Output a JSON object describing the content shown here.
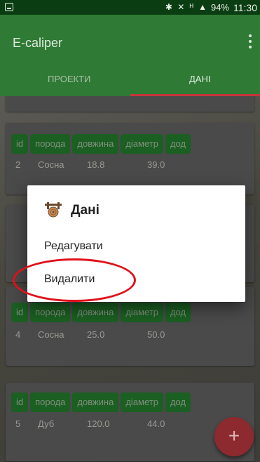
{
  "status_bar": {
    "system_icons": "✱ ✕ ᴴ ▲",
    "battery": "94%",
    "time": "11:30"
  },
  "app": {
    "title": "E-caliper"
  },
  "tabs": [
    {
      "label": "ПРОЕКТИ",
      "selected": false
    },
    {
      "label": "ДАНІ",
      "selected": true
    }
  ],
  "colors": {
    "primary": "#2f7a34",
    "primary_dark": "#0b3d12",
    "accent": "#c7353a",
    "annotation": "#e0101a"
  },
  "columns": [
    "id",
    "порода",
    "довжина",
    "діаметр",
    "дод"
  ],
  "records": [
    {
      "id": "2",
      "species": "Сосна",
      "length": "18.8",
      "diameter": "39.0"
    },
    {
      "id": "4",
      "species": "Сосна",
      "length": "25.0",
      "diameter": "50.0"
    },
    {
      "id": "5",
      "species": "Дуб",
      "length": "120.0",
      "diameter": "44.0"
    }
  ],
  "dialog": {
    "title": "Дані",
    "items": [
      {
        "label": "Редагувати"
      },
      {
        "label": "Видалити"
      }
    ]
  },
  "fab": {
    "icon": "plus-icon",
    "label": "+"
  }
}
